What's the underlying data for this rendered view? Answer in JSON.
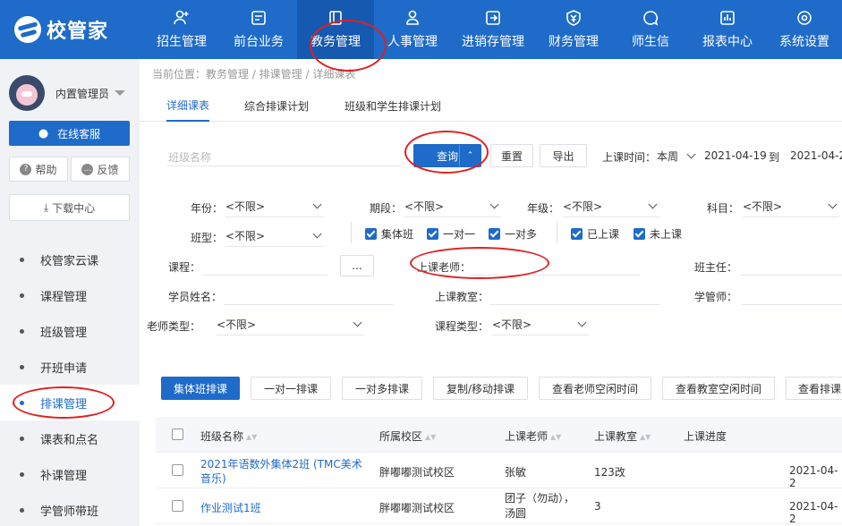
{
  "brand": {
    "name": "校管家"
  },
  "nav": [
    {
      "label": "招生管理",
      "icon": "user-plus-icon"
    },
    {
      "label": "前台业务",
      "icon": "monitor-icon"
    },
    {
      "label": "教务管理",
      "icon": "book-icon"
    },
    {
      "label": "人事管理",
      "icon": "person-icon"
    },
    {
      "label": "进销存管理",
      "icon": "box-arrow-icon"
    },
    {
      "label": "财务管理",
      "icon": "yen-shield-icon"
    },
    {
      "label": "师生信",
      "icon": "chat-icon"
    },
    {
      "label": "报表中心",
      "icon": "report-icon"
    },
    {
      "label": "系统设置",
      "icon": "gear-icon"
    }
  ],
  "sidebar": {
    "username": "内置管理员",
    "service_label": "在线客服",
    "help_label": "帮助",
    "feedback_label": "反馈",
    "download_label": "下载中心",
    "items": [
      "校管家云课",
      "课程管理",
      "班级管理",
      "开班申请",
      "排课管理",
      "课表和点名",
      "补课管理",
      "学管师带班"
    ]
  },
  "breadcrumb": "当前位置：教务管理 / 排课管理 / 详细课表",
  "tabs": [
    "详细课表",
    "综合排课计划",
    "班级和学生排课计划"
  ],
  "filters": {
    "class_name_placeholder": "班级名称",
    "query_label": "查询",
    "reset_label": "重置",
    "export_label": "导出",
    "time_label": "上课时间：",
    "time_range": "本周",
    "date_from": "2021-04-19",
    "to_label": "到",
    "date_to": "2021-04-2",
    "year_label": "年份：",
    "year_value": "<不限>",
    "term_label": "期段：",
    "term_value": "<不限>",
    "grade_label": "年级：",
    "grade_value": "<不限>",
    "subject_label": "科目：",
    "subject_value": "<不限>",
    "class_type_label": "班型：",
    "class_type_value": "<不限>",
    "checkboxes": [
      "集体班",
      "一对一",
      "一对多",
      "已上课",
      "未上课"
    ],
    "course_label": "课程：",
    "course_btn": "...",
    "teacher_label": "上课老师：",
    "head_teacher_label": "班主任：",
    "student_label": "学员姓名：",
    "classroom_label": "上课教室：",
    "manager_label": "学管师：",
    "teacher_type_label": "老师类型：",
    "teacher_type_value": "<不限>",
    "course_type_label": "课程类型：",
    "course_type_value": "<不限>"
  },
  "actions": [
    "集体班排课",
    "一对一排课",
    "一对多排课",
    "复制/移动排课",
    "查看老师空闲时间",
    "查看教室空闲时间",
    "查看排课"
  ],
  "table": {
    "headers": [
      "班级名称",
      "所属校区",
      "上课老师",
      "上课教室",
      "上课进度"
    ],
    "rows": [
      {
        "class_name_1": "2021年语数外集体2班 (TMC美术",
        "class_name_2": "音乐)",
        "campus": "胖嘟嘟测试校区",
        "teacher_1": "张敏",
        "teacher_2": "",
        "room": "123改",
        "date": "2021-04-2"
      },
      {
        "class_name_1": "作业测试1班",
        "class_name_2": "",
        "campus": "胖嘟嘟测试校区",
        "teacher_1": "团子（勿动），",
        "teacher_2": "汤圆",
        "room": "3",
        "date": "2021-04-2"
      }
    ]
  },
  "colors": {
    "primary": "#1e6bc9",
    "annotation": "#e02020"
  }
}
